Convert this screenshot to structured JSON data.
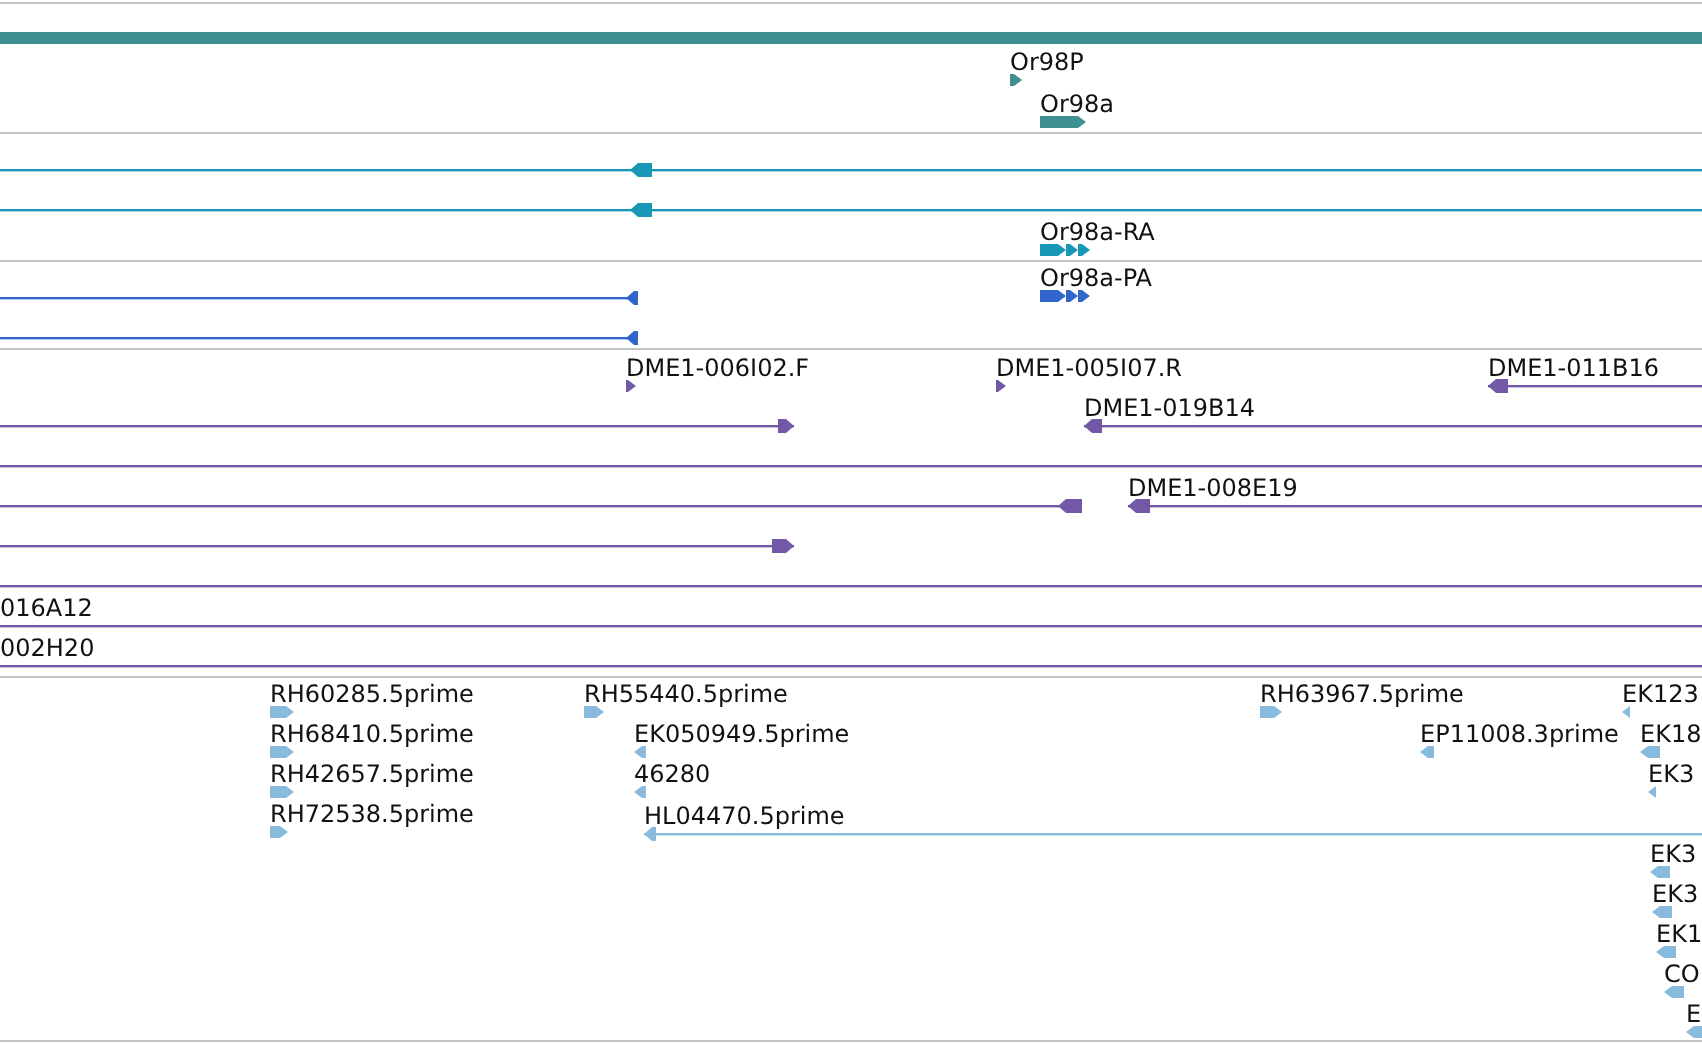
{
  "tracks": [
    {
      "color": "#3f9090",
      "features": [
        {
          "kind": "span"
        },
        {
          "label": "Or98P",
          "kind": "block",
          "forward": true
        },
        {
          "label": "Or98a",
          "kind": "block",
          "forward": true
        }
      ]
    },
    {
      "color": "#1898b4",
      "features": [
        {
          "kind": "line",
          "forward": false
        },
        {
          "kind": "line",
          "forward": false
        },
        {
          "label": "Or98a-RA",
          "kind": "exons",
          "forward": true
        }
      ]
    },
    {
      "color": "#3366cc",
      "features": [
        {
          "kind": "line",
          "forward": false
        },
        {
          "kind": "line",
          "forward": false
        },
        {
          "label": "Or98a-PA",
          "kind": "exons",
          "forward": true
        }
      ]
    },
    {
      "color": "#7358a8",
      "features": [
        {
          "label": "DME1-006I02.F",
          "kind": "block",
          "forward": true
        },
        {
          "kind": "line",
          "forward": true
        },
        {
          "label": "DME1-005I07.R",
          "kind": "block",
          "forward": true
        },
        {
          "label": "DME1-011B16",
          "kind": "line",
          "forward": false
        },
        {
          "label": "DME1-019B14",
          "kind": "line",
          "forward": false
        },
        {
          "kind": "line"
        },
        {
          "kind": "line",
          "forward": false
        },
        {
          "label": "DME1-008E19",
          "kind": "line",
          "forward": false
        },
        {
          "kind": "line",
          "forward": true
        },
        {
          "kind": "line"
        },
        {
          "label": "016A12",
          "kind": "line"
        },
        {
          "label": "002H20",
          "kind": "line"
        }
      ]
    },
    {
      "color": "#88bbdd",
      "features": [
        {
          "label": "RH60285.5prime",
          "kind": "block",
          "forward": true
        },
        {
          "label": "RH68410.5prime",
          "kind": "block",
          "forward": true
        },
        {
          "label": "RH42657.5prime",
          "kind": "block",
          "forward": true
        },
        {
          "label": "RH72538.5prime",
          "kind": "block",
          "forward": true
        },
        {
          "label": "RH55440.5prime",
          "kind": "block",
          "forward": true
        },
        {
          "label": "EK050949.5prime",
          "kind": "block",
          "forward": false
        },
        {
          "label": "46280",
          "kind": "block",
          "forward": false
        },
        {
          "label": "HL04470.5prime",
          "kind": "line",
          "forward": false
        },
        {
          "label": "RH63967.5prime",
          "kind": "block",
          "forward": true
        },
        {
          "label": "EP11008.3prime",
          "kind": "block",
          "forward": false
        },
        {
          "label": "EK123",
          "kind": "block",
          "forward": false
        },
        {
          "label": "EK18",
          "kind": "block",
          "forward": false
        },
        {
          "label": "EK3",
          "kind": "block",
          "forward": false
        },
        {
          "label": "EK3",
          "kind": "block",
          "forward": false
        },
        {
          "label": "EK3",
          "kind": "block",
          "forward": false
        },
        {
          "label": "EK1",
          "kind": "block",
          "forward": false
        },
        {
          "label": "CO",
          "kind": "block",
          "forward": false
        },
        {
          "label": "E",
          "kind": "block",
          "forward": false
        }
      ]
    }
  ]
}
